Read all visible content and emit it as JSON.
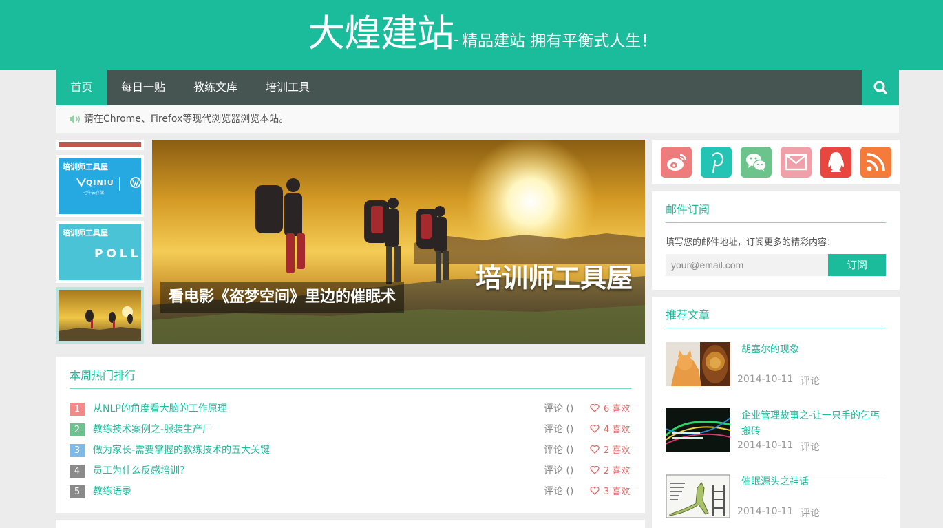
{
  "header": {
    "title": "大煌建站",
    "separator": "-",
    "tagline": "精品建站 拥有平衡式人生！"
  },
  "nav": {
    "items": [
      "首页",
      "每日一贴",
      "教练文库",
      "培训工具"
    ],
    "search_icon": "search-icon"
  },
  "notice": {
    "icon": "speaker-icon",
    "text": "请在Chrome、Firefox等现代浏览器浏览本站。"
  },
  "thumbnails": [
    {
      "label": "培训师工具屋",
      "brand": "QINIU",
      "brand_sub": "七牛云存储"
    },
    {
      "label": "培训师工具屋",
      "brand": "POLL"
    }
  ],
  "slider": {
    "brand": "培训师工具屋",
    "caption": "看电影《盗梦空间》里边的催眠术"
  },
  "hot": {
    "title": "本周热门排行",
    "items": [
      {
        "rank": "1",
        "title": "从NLP的角度看大脑的工作原理",
        "comment": "评论 ()",
        "likes": "6 喜欢",
        "color": "#f28a8a"
      },
      {
        "rank": "2",
        "title": "教练技术案例之-服装生产厂",
        "comment": "评论 ()",
        "likes": "4 喜欢",
        "color": "#6cc18f"
      },
      {
        "rank": "3",
        "title": "做为家长-需要掌握的教练技术的五大关键",
        "comment": "评论 ()",
        "likes": "2 喜欢",
        "color": "#7fb9e5"
      },
      {
        "rank": "4",
        "title": "员工为什么反感培训？",
        "comment": "评论 ()",
        "likes": "2 喜欢",
        "color": "#8a8a8a"
      },
      {
        "rank": "5",
        "title": "教练语录",
        "comment": "评论 ()",
        "likes": "3 喜欢",
        "color": "#8a8a8a"
      }
    ]
  },
  "social": [
    {
      "name": "weibo-icon",
      "color": "#ef7c7c"
    },
    {
      "name": "pinterest-icon",
      "color": "#23c4b4"
    },
    {
      "name": "wechat-icon",
      "color": "#6cc38b"
    },
    {
      "name": "mail-icon",
      "color": "#f0a0a8"
    },
    {
      "name": "qq-icon",
      "color": "#e8473f"
    },
    {
      "name": "rss-icon",
      "color": "#f57b3a"
    }
  ],
  "mail": {
    "title": "邮件订阅",
    "desc": "填写您的邮件地址，订阅更多的精彩内容：",
    "placeholder": "your@email.com",
    "button": "订阅"
  },
  "recommend": {
    "title": "推荐文章",
    "items": [
      {
        "title": "胡塞尔的现象",
        "date": "2014-10-11",
        "comment": "评论"
      },
      {
        "title": "企业管理故事之-让一只手的乞丐搬砖",
        "date": "2014-10-11",
        "comment": "评论"
      },
      {
        "title": "催眠源头之神话",
        "date": "2014-10-11",
        "comment": "评论"
      }
    ]
  },
  "colors": {
    "accent": "#1bbc9b",
    "nav_bg": "#475552",
    "page_bg": "#ececec"
  }
}
